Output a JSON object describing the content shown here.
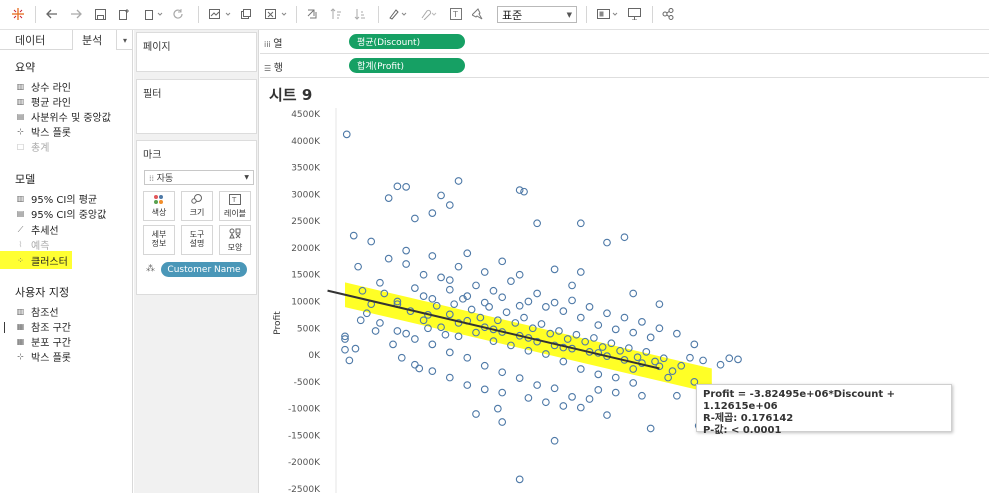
{
  "toolbar": {
    "view_dropdown": "표준"
  },
  "left_panel": {
    "tabs": {
      "data": "데이터",
      "analysis": "분석"
    },
    "summary": {
      "title": "요약",
      "items": [
        {
          "label": "상수 라인",
          "icon": "bars-icon",
          "disabled": false
        },
        {
          "label": "평균 라인",
          "icon": "bars-icon",
          "disabled": false
        },
        {
          "label": "사분위수 및 중앙값",
          "icon": "box-icon",
          "disabled": false
        },
        {
          "label": "박스 플롯",
          "icon": "boxplot-icon",
          "disabled": false
        },
        {
          "label": "총계",
          "icon": "total-icon",
          "disabled": true
        }
      ]
    },
    "model": {
      "title": "모델",
      "items": [
        {
          "label": "95% CI의 평균",
          "icon": "bars-icon",
          "disabled": false
        },
        {
          "label": "95% CI의 중앙값",
          "icon": "box-icon",
          "disabled": false
        },
        {
          "label": "추세선",
          "icon": "trend-icon",
          "disabled": false,
          "highlighted": true
        },
        {
          "label": "예측",
          "icon": "forecast-icon",
          "disabled": true
        },
        {
          "label": "클러스터",
          "icon": "cluster-icon",
          "disabled": false
        }
      ]
    },
    "custom": {
      "title": "사용자 지정",
      "items": [
        {
          "label": "참조선",
          "icon": "bars-icon",
          "disabled": false
        },
        {
          "label": "참조 구간",
          "icon": "band-icon",
          "disabled": false
        },
        {
          "label": "분포 구간",
          "icon": "band-icon",
          "disabled": false
        },
        {
          "label": "박스 플롯",
          "icon": "boxplot-icon",
          "disabled": false
        }
      ]
    }
  },
  "middle_panel": {
    "pages": "페이지",
    "filters": "필터",
    "marks": "마크",
    "mark_type": "자동",
    "buttons": [
      {
        "label": "색상",
        "icon": "color-icon"
      },
      {
        "label": "크기",
        "icon": "size-icon"
      },
      {
        "label": "레이블",
        "icon": "label-icon"
      },
      {
        "label": "세부\n정보",
        "icon": "detail-icon"
      },
      {
        "label": "도구\n설명",
        "icon": "tooltip-icon"
      },
      {
        "label": "모양",
        "icon": "shape-icon"
      }
    ],
    "detail_pill": "Customer Name"
  },
  "shelves": {
    "columns_label": "열",
    "columns_pill": "평균(Discount)",
    "rows_label": "행",
    "rows_pill": "합계(Profit)"
  },
  "view": {
    "sheet_title": "시트 9"
  },
  "tooltip": {
    "line1": "Profit = -3.82495e+06*Discount + 1.12615e+06",
    "line2": "R-제곱: 0.176142",
    "line3": "P-값: < 0.0001"
  },
  "chart_data": {
    "type": "scatter",
    "ylabel": "Profit",
    "xlabel": "",
    "x_field": "평균(Discount)",
    "xlim": [
      0.0,
      0.45
    ],
    "ylim": [
      -2500000,
      4500000
    ],
    "yticks": [
      "4500K",
      "4000K",
      "3500K",
      "3000K",
      "2500K",
      "2000K",
      "1500K",
      "1000K",
      "500K",
      "0K",
      "-500K",
      "-1000K",
      "-1500K",
      "-2000K",
      "-2500K"
    ],
    "trendline": {
      "slope": -3824950,
      "intercept": 1126150
    },
    "point_color": "#4e79a7",
    "trend_color": "#333333",
    "highlight_color": "#ffff00",
    "points": [
      [
        0.002,
        4120000
      ],
      [
        0.01,
        2230000
      ],
      [
        0.015,
        1650000
      ],
      [
        0.03,
        2120000
      ],
      [
        0.06,
        3150000
      ],
      [
        0.07,
        3140000
      ],
      [
        0.13,
        3250000
      ],
      [
        0.2,
        3080000
      ],
      [
        0.205,
        3050000
      ],
      [
        0.11,
        2980000
      ],
      [
        0.05,
        2930000
      ],
      [
        0.22,
        2460000
      ],
      [
        0.27,
        2460000
      ],
      [
        0.32,
        2200000
      ],
      [
        0.3,
        2100000
      ],
      [
        0.12,
        2800000
      ],
      [
        0.1,
        2650000
      ],
      [
        0.08,
        2550000
      ],
      [
        0.0,
        100000
      ],
      [
        0.0,
        300000
      ],
      [
        0.0,
        350000
      ],
      [
        0.005,
        -100000
      ],
      [
        0.012,
        120000
      ],
      [
        0.018,
        650000
      ],
      [
        0.025,
        780000
      ],
      [
        0.04,
        1350000
      ],
      [
        0.045,
        1150000
      ],
      [
        0.06,
        950000
      ],
      [
        0.075,
        820000
      ],
      [
        0.09,
        1100000
      ],
      [
        0.105,
        920000
      ],
      [
        0.12,
        760000
      ],
      [
        0.14,
        640000
      ],
      [
        0.16,
        520000
      ],
      [
        0.18,
        430000
      ],
      [
        0.2,
        360000
      ],
      [
        0.22,
        250000
      ],
      [
        0.24,
        180000
      ],
      [
        0.26,
        120000
      ],
      [
        0.28,
        60000
      ],
      [
        0.3,
        -20000
      ],
      [
        0.32,
        -90000
      ],
      [
        0.34,
        -150000
      ],
      [
        0.36,
        -210000
      ],
      [
        0.05,
        1800000
      ],
      [
        0.07,
        1700000
      ],
      [
        0.09,
        1500000
      ],
      [
        0.11,
        1450000
      ],
      [
        0.13,
        1650000
      ],
      [
        0.15,
        1300000
      ],
      [
        0.17,
        1200000
      ],
      [
        0.19,
        1380000
      ],
      [
        0.21,
        1000000
      ],
      [
        0.23,
        900000
      ],
      [
        0.25,
        820000
      ],
      [
        0.27,
        700000
      ],
      [
        0.29,
        560000
      ],
      [
        0.31,
        480000
      ],
      [
        0.33,
        420000
      ],
      [
        0.35,
        330000
      ],
      [
        0.04,
        600000
      ],
      [
        0.06,
        450000
      ],
      [
        0.08,
        300000
      ],
      [
        0.1,
        200000
      ],
      [
        0.12,
        50000
      ],
      [
        0.14,
        -50000
      ],
      [
        0.16,
        -200000
      ],
      [
        0.18,
        -320000
      ],
      [
        0.2,
        -430000
      ],
      [
        0.22,
        -560000
      ],
      [
        0.24,
        -620000
      ],
      [
        0.26,
        -780000
      ],
      [
        0.28,
        -820000
      ],
      [
        0.15,
        -1100000
      ],
      [
        0.175,
        -1000000
      ],
      [
        0.27,
        -980000
      ],
      [
        0.34,
        -760000
      ],
      [
        0.38,
        -760000
      ],
      [
        0.4,
        -500000
      ],
      [
        0.42,
        -1250000
      ],
      [
        0.405,
        -1320000
      ],
      [
        0.35,
        -1370000
      ],
      [
        0.2,
        -2320000
      ],
      [
        0.24,
        -1600000
      ],
      [
        0.18,
        -1250000
      ],
      [
        0.3,
        -1120000
      ],
      [
        0.02,
        1200000
      ],
      [
        0.03,
        950000
      ],
      [
        0.035,
        450000
      ],
      [
        0.055,
        200000
      ],
      [
        0.065,
        -50000
      ],
      [
        0.085,
        -250000
      ],
      [
        0.095,
        500000
      ],
      [
        0.115,
        380000
      ],
      [
        0.125,
        950000
      ],
      [
        0.135,
        1050000
      ],
      [
        0.145,
        850000
      ],
      [
        0.155,
        700000
      ],
      [
        0.165,
        900000
      ],
      [
        0.175,
        650000
      ],
      [
        0.185,
        800000
      ],
      [
        0.195,
        600000
      ],
      [
        0.205,
        700000
      ],
      [
        0.215,
        500000
      ],
      [
        0.225,
        580000
      ],
      [
        0.235,
        400000
      ],
      [
        0.245,
        450000
      ],
      [
        0.255,
        300000
      ],
      [
        0.265,
        380000
      ],
      [
        0.275,
        250000
      ],
      [
        0.285,
        320000
      ],
      [
        0.295,
        150000
      ],
      [
        0.305,
        220000
      ],
      [
        0.315,
        80000
      ],
      [
        0.325,
        130000
      ],
      [
        0.335,
        -40000
      ],
      [
        0.345,
        60000
      ],
      [
        0.355,
        -120000
      ],
      [
        0.365,
        -60000
      ],
      [
        0.375,
        -300000
      ],
      [
        0.385,
        -200000
      ],
      [
        0.395,
        -50000
      ],
      [
        0.41,
        -100000
      ],
      [
        0.43,
        -180000
      ],
      [
        0.44,
        -60000
      ],
      [
        0.45,
        -80000
      ],
      [
        0.08,
        1250000
      ],
      [
        0.1,
        1050000
      ],
      [
        0.12,
        1220000
      ],
      [
        0.14,
        1100000
      ],
      [
        0.16,
        980000
      ],
      [
        0.18,
        1080000
      ],
      [
        0.2,
        920000
      ],
      [
        0.22,
        1150000
      ],
      [
        0.24,
        980000
      ],
      [
        0.26,
        1020000
      ],
      [
        0.28,
        900000
      ],
      [
        0.3,
        780000
      ],
      [
        0.32,
        700000
      ],
      [
        0.34,
        620000
      ],
      [
        0.36,
        500000
      ],
      [
        0.07,
        400000
      ],
      [
        0.09,
        650000
      ],
      [
        0.11,
        520000
      ],
      [
        0.13,
        350000
      ],
      [
        0.15,
        420000
      ],
      [
        0.17,
        260000
      ],
      [
        0.19,
        180000
      ],
      [
        0.21,
        80000
      ],
      [
        0.23,
        20000
      ],
      [
        0.25,
        -120000
      ],
      [
        0.27,
        -260000
      ],
      [
        0.29,
        -360000
      ],
      [
        0.31,
        -420000
      ],
      [
        0.33,
        -520000
      ],
      [
        0.08,
        -180000
      ],
      [
        0.1,
        -300000
      ],
      [
        0.12,
        -420000
      ],
      [
        0.14,
        -560000
      ],
      [
        0.16,
        -640000
      ],
      [
        0.18,
        -700000
      ],
      [
        0.21,
        -800000
      ],
      [
        0.23,
        -880000
      ],
      [
        0.25,
        -950000
      ],
      [
        0.29,
        -650000
      ],
      [
        0.31,
        -700000
      ],
      [
        0.07,
        1950000
      ],
      [
        0.1,
        1850000
      ],
      [
        0.14,
        1900000
      ],
      [
        0.18,
        1750000
      ],
      [
        0.24,
        1600000
      ],
      [
        0.27,
        1550000
      ],
      [
        0.33,
        1150000
      ],
      [
        0.36,
        950000
      ],
      [
        0.38,
        400000
      ],
      [
        0.4,
        200000
      ],
      [
        0.12,
        1400000
      ],
      [
        0.16,
        1550000
      ],
      [
        0.2,
        1500000
      ],
      [
        0.26,
        1300000
      ],
      [
        0.06,
        1000000
      ],
      [
        0.095,
        750000
      ],
      [
        0.13,
        600000
      ],
      [
        0.17,
        480000
      ],
      [
        0.21,
        320000
      ],
      [
        0.25,
        140000
      ],
      [
        0.29,
        40000
      ],
      [
        0.33,
        -260000
      ],
      [
        0.37,
        -420000
      ]
    ]
  }
}
